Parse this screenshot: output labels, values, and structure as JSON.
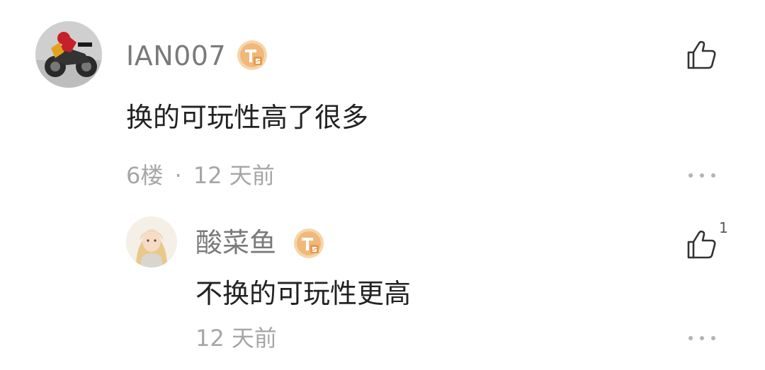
{
  "comment": {
    "username": "IAN007",
    "badge_icon": "ts-member-badge",
    "text": "换的可玩性高了很多",
    "floor": "6楼",
    "separator": "·",
    "time": "12 天前",
    "like_icon": "thumbs-up-icon",
    "more_icon": "more-dots-icon"
  },
  "reply": {
    "username": "酸菜鱼",
    "badge_icon": "ts-member-badge",
    "text": "不换的可玩性更高",
    "time": "12 天前",
    "like_count": "1",
    "like_icon": "thumbs-up-icon",
    "more_icon": "more-dots-icon"
  },
  "colors": {
    "username": "#7a7a7a",
    "meta": "#a6a6a6",
    "text": "#222222",
    "badge": "#f0b87a"
  }
}
